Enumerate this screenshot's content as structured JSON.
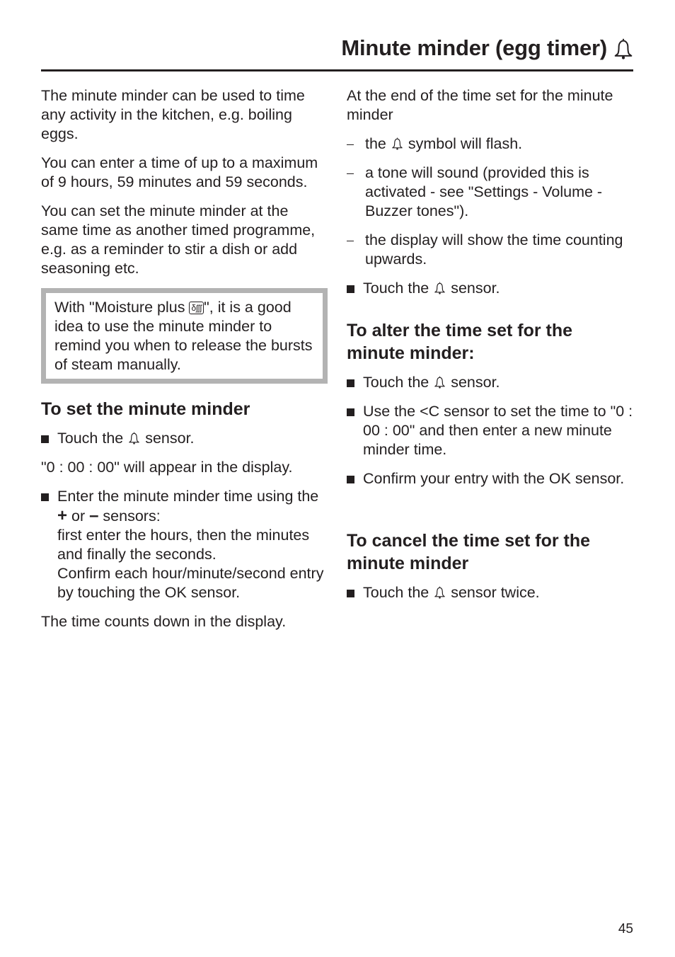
{
  "header": {
    "title": "Minute minder (egg timer)",
    "title_icon": "bell-icon"
  },
  "left_column": {
    "intro_paragraphs": [
      "The minute minder can be used to time any activity in the kitchen, e.g. boiling eggs.",
      "You can enter a time of up to a maximum of 9 hours, 59 minutes and 59 seconds.",
      "You can set the minute minder at the same time as another timed programme, e.g. as a reminder to stir a dish or add seasoning etc."
    ],
    "note": {
      "before": "With \"Moisture plus ",
      "icon_label": "δʃʃʃ",
      "icon": "moisture-plus-icon",
      "after": "\", it is a good idea to use the minute minder to remind you when to release the bursts of steam manually."
    },
    "set_section": {
      "heading": "To set the minute minder",
      "step1_before": "Touch the ",
      "step1_after": " sensor.",
      "display_text": "\"0 : 00 : 00\" will appear in the display.",
      "step2_line1": "Enter the minute minder time using the ",
      "plus_symbol": "+",
      "or_text": " or ",
      "minus_symbol": "–",
      "step2_line1_end": " sensors:",
      "step2_line2": "first enter the hours, then the minutes and finally the seconds.",
      "step2_line3": "Confirm each hour/minute/second entry by touching the OK sensor.",
      "countdown_text": "The time counts down in the display."
    }
  },
  "right_column": {
    "end_intro": "At the end of the time set for the minute minder",
    "dash_items": {
      "item1_before": "the ",
      "item1_after": " symbol will flash.",
      "item2": "a tone will sound (provided this is activated - see \"Settings - Volume - Buzzer tones\").",
      "item3": "the display will show the time counting upwards."
    },
    "end_step_before": "Touch the ",
    "end_step_after": " sensor.",
    "alter_section": {
      "heading": "To alter the time set for the minute minder:",
      "step1_before": "Touch the ",
      "step1_after": " sensor.",
      "step2_before": "Use the ",
      "step2_symbol": "<C",
      "step2_after": " sensor to set the time to \"0 : 00 : 00\" and then enter a new minute minder time.",
      "step3": "Confirm your entry with the OK sensor."
    },
    "cancel_section": {
      "heading": "To cancel the time set for the minute minder",
      "step1_before": "Touch the ",
      "step1_after": " sensor twice."
    }
  },
  "footer": {
    "page_number": "45"
  }
}
